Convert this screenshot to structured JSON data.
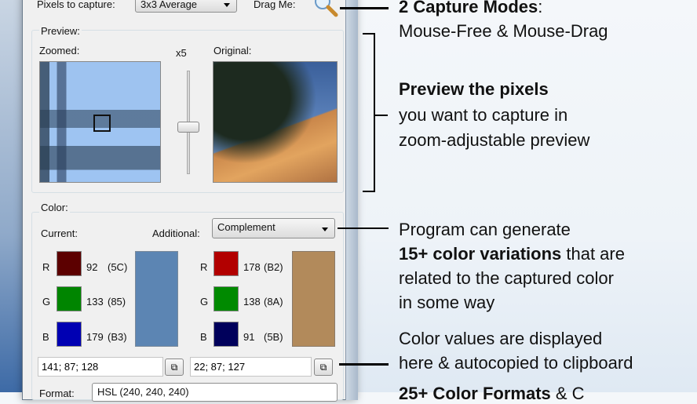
{
  "window": {
    "pixels_to_capture_label": "Pixels to capture:",
    "pixels_to_capture_value": "3x3 Average",
    "drag_me_label": "Drag Me:",
    "preview_group": "Preview:",
    "zoomed_label": "Zoomed:",
    "zoom_level": "x5",
    "original_label": "Original:",
    "color_group": "Color:",
    "current_label": "Current:",
    "additional_label": "Additional:",
    "additional_value": "Complement",
    "current": {
      "rows": [
        {
          "ch": "R",
          "value": "92",
          "hex": "(5C)",
          "color": "#5c0000"
        },
        {
          "ch": "G",
          "value": "133",
          "hex": "(85)",
          "color": "#008500"
        },
        {
          "ch": "B",
          "value": "179",
          "hex": "(B3)",
          "color": "#0000b3"
        }
      ],
      "swatch": "#5c85b3",
      "text": "141; 87; 128"
    },
    "additional": {
      "rows": [
        {
          "ch": "R",
          "value": "178",
          "hex": "(B2)",
          "color": "#b20000"
        },
        {
          "ch": "G",
          "value": "138",
          "hex": "(8A)",
          "color": "#008a00"
        },
        {
          "ch": "B",
          "value": "91",
          "hex": "(5B)",
          "color": "#00005b"
        }
      ],
      "swatch": "#b28a5b",
      "text": "22; 87; 127"
    },
    "format_label": "Format:",
    "format_value": "HSL (240, 240, 240)"
  },
  "annotations": {
    "capture_title": "2 Capture Modes",
    "capture_colon": ":",
    "capture_sub": "Mouse-Free & Mouse-Drag",
    "preview_title": "Preview the pixels",
    "preview_l1": "you want to capture in",
    "preview_l2": "zoom-adjustable preview",
    "gen_l1": "Program can generate",
    "gen_bold": "15+ color variations",
    "gen_rest": " that are",
    "gen_l3": "related to the captured color",
    "gen_l4": "in some way",
    "values_l1": "Color values are displayed",
    "values_l2": "here & autocopied to clipboard",
    "formats_bold": "25+ Color Formats",
    "formats_rest": " & C"
  }
}
